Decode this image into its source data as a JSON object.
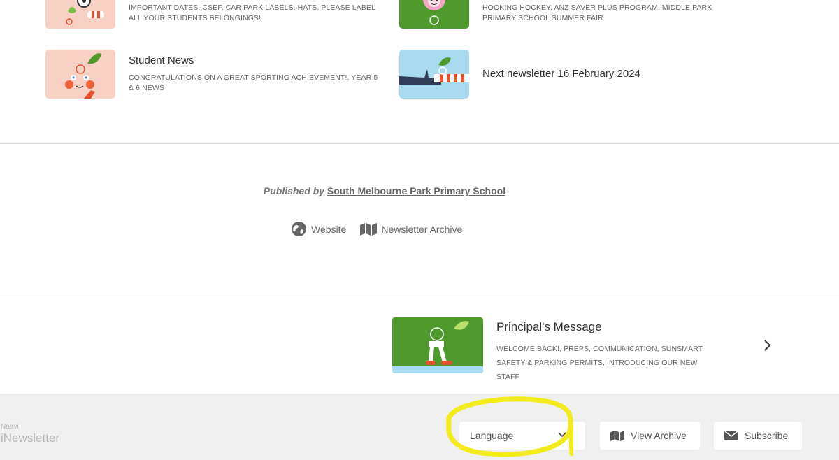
{
  "cards": [
    {
      "title": "",
      "subtitle": "IMPORTANT DATES, CSEF, CAR PARK LABELS, HATS, PLEASE LABEL ALL YOUR STUDENTS BELONGINGS!",
      "icon": "sportsday-thumbnail"
    },
    {
      "title": "",
      "subtitle": "HOOKING HOCKEY, ANZ SAVER PLUS PROGRAM, MIDDLE PARK PRIMARY SCHOOL SUMMER FAIR",
      "icon": "flower-thumbnail"
    },
    {
      "title": "Student News",
      "subtitle": "CONGRATULATIONS ON A GREAT SPORTING ACHIEVEMENT!, YEAR 5 & 6 NEWS",
      "icon": "face-thumbnail"
    },
    {
      "title": "Next newsletter 16 February 2024",
      "subtitle": "",
      "icon": "branch-thumbnail"
    }
  ],
  "publisher": {
    "prefix": "Published by",
    "name": "South Melbourne Park Primary School"
  },
  "links": {
    "website": "Website",
    "archive": "Newsletter Archive"
  },
  "next_article": {
    "title": "Principal's Message",
    "subtitle": "WELCOME BACK!, PREPS, COMMUNICATION, SUNSMART, SAFETY & PARKING PERMITS, INTRODUCING OUR NEW STAFF"
  },
  "footer": {
    "brand_small": "Naavi",
    "brand_big": "iNewsletter",
    "language_label": "Language",
    "view_archive_label": "View Archive",
    "subscribe_label": "Subscribe"
  },
  "colors": {
    "peach": "#f8d0c4",
    "green": "#5a9e2f",
    "sky": "#a8dbef",
    "highlight": "#f2ec1c",
    "footer_bg": "#f0f0f0"
  }
}
